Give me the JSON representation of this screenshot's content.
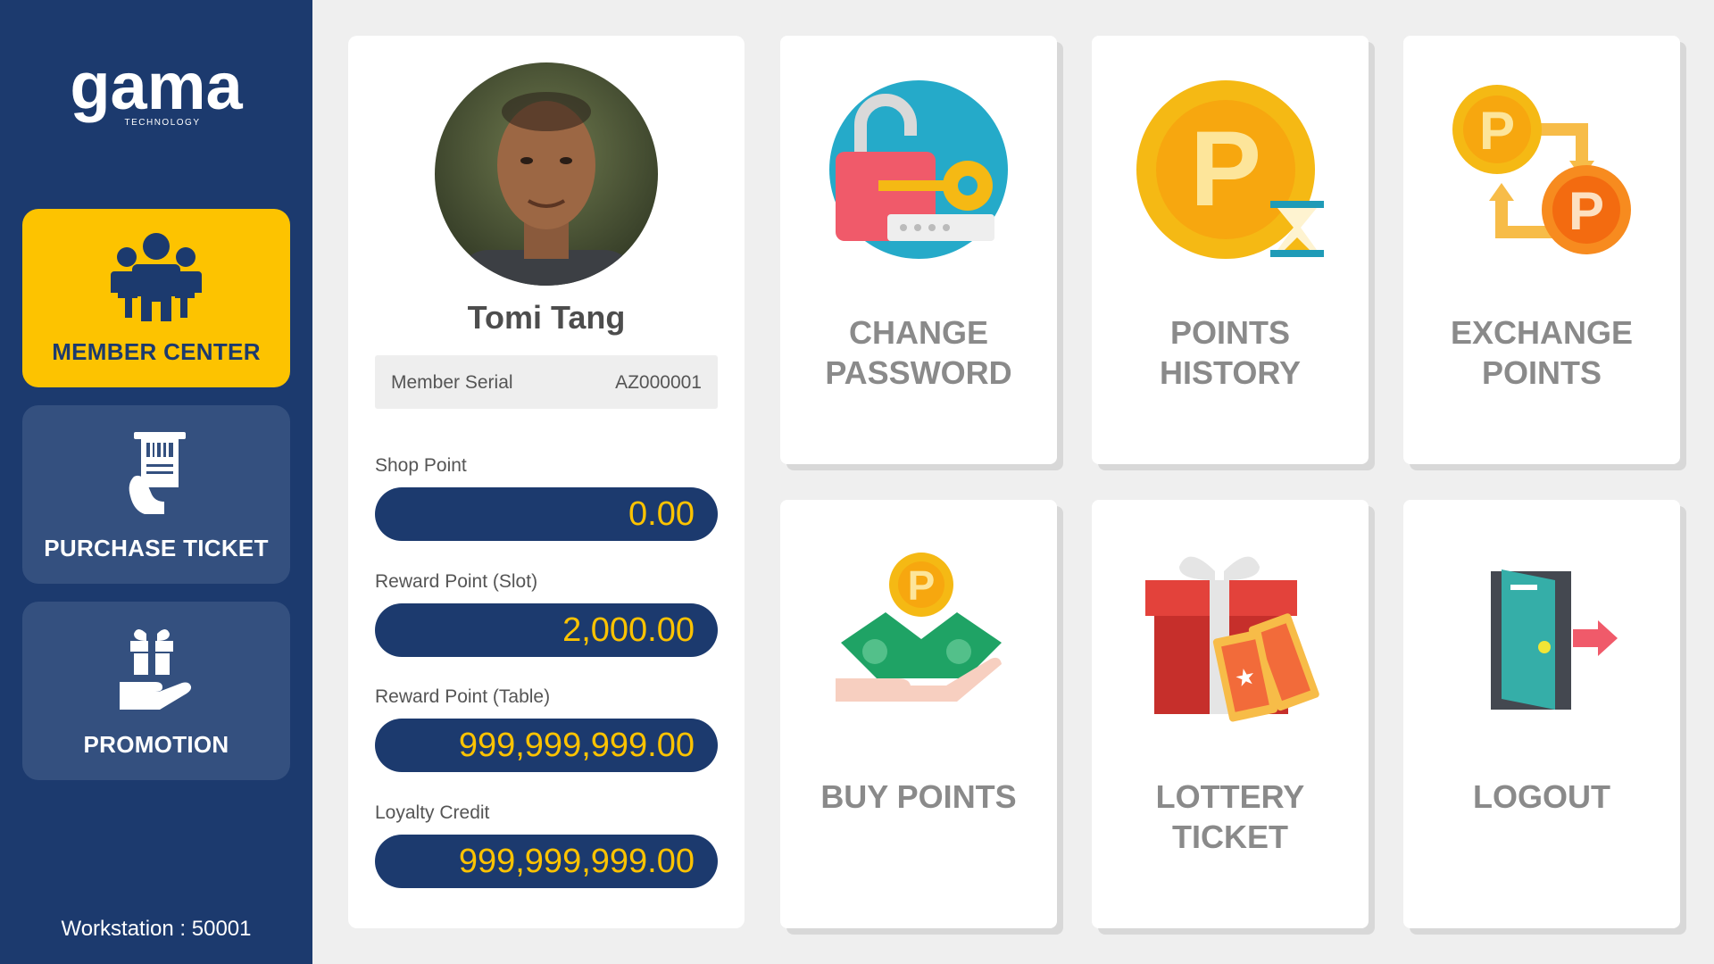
{
  "brand": {
    "logo_text": "gama",
    "logo_subtext": "TECHNOLOGY"
  },
  "sidebar": {
    "items": [
      {
        "label": "MEMBER CENTER",
        "icon": "people-group-icon",
        "active": true
      },
      {
        "label": "PURCHASE TICKET",
        "icon": "ticket-hand-icon",
        "active": false
      },
      {
        "label": "PROMOTION",
        "icon": "gift-hand-icon",
        "active": false
      }
    ],
    "workstation": "Workstation : 50001"
  },
  "profile": {
    "name": "Tomi Tang",
    "serial_label": "Member Serial",
    "serial_value": "AZ000001",
    "points": [
      {
        "label": "Shop Point",
        "value": "0.00"
      },
      {
        "label": "Reward Point (Slot)",
        "value": "2,000.00"
      },
      {
        "label": "Reward Point (Table)",
        "value": "999,999,999.00"
      },
      {
        "label": "Loyalty Credit",
        "value": "999,999,999.00"
      }
    ]
  },
  "tiles": [
    {
      "label": "CHANGE\nPASSWORD",
      "icon": "lock-key-icon"
    },
    {
      "label": "POINTS\nHISTORY",
      "icon": "coin-hourglass-icon"
    },
    {
      "label": "EXCHANGE\nPOINTS",
      "icon": "coin-exchange-icon"
    },
    {
      "label": "BUY POINTS",
      "icon": "money-hand-coin-icon"
    },
    {
      "label": "LOTTERY\nTICKET",
      "icon": "gift-tickets-icon"
    },
    {
      "label": "LOGOUT",
      "icon": "door-exit-icon"
    }
  ],
  "colors": {
    "sidebar_bg": "#1c3a6e",
    "nav_inactive": "#34507f",
    "accent_yellow": "#fdc300",
    "tile_label": "#8a8a8a",
    "background": "#efefef"
  }
}
